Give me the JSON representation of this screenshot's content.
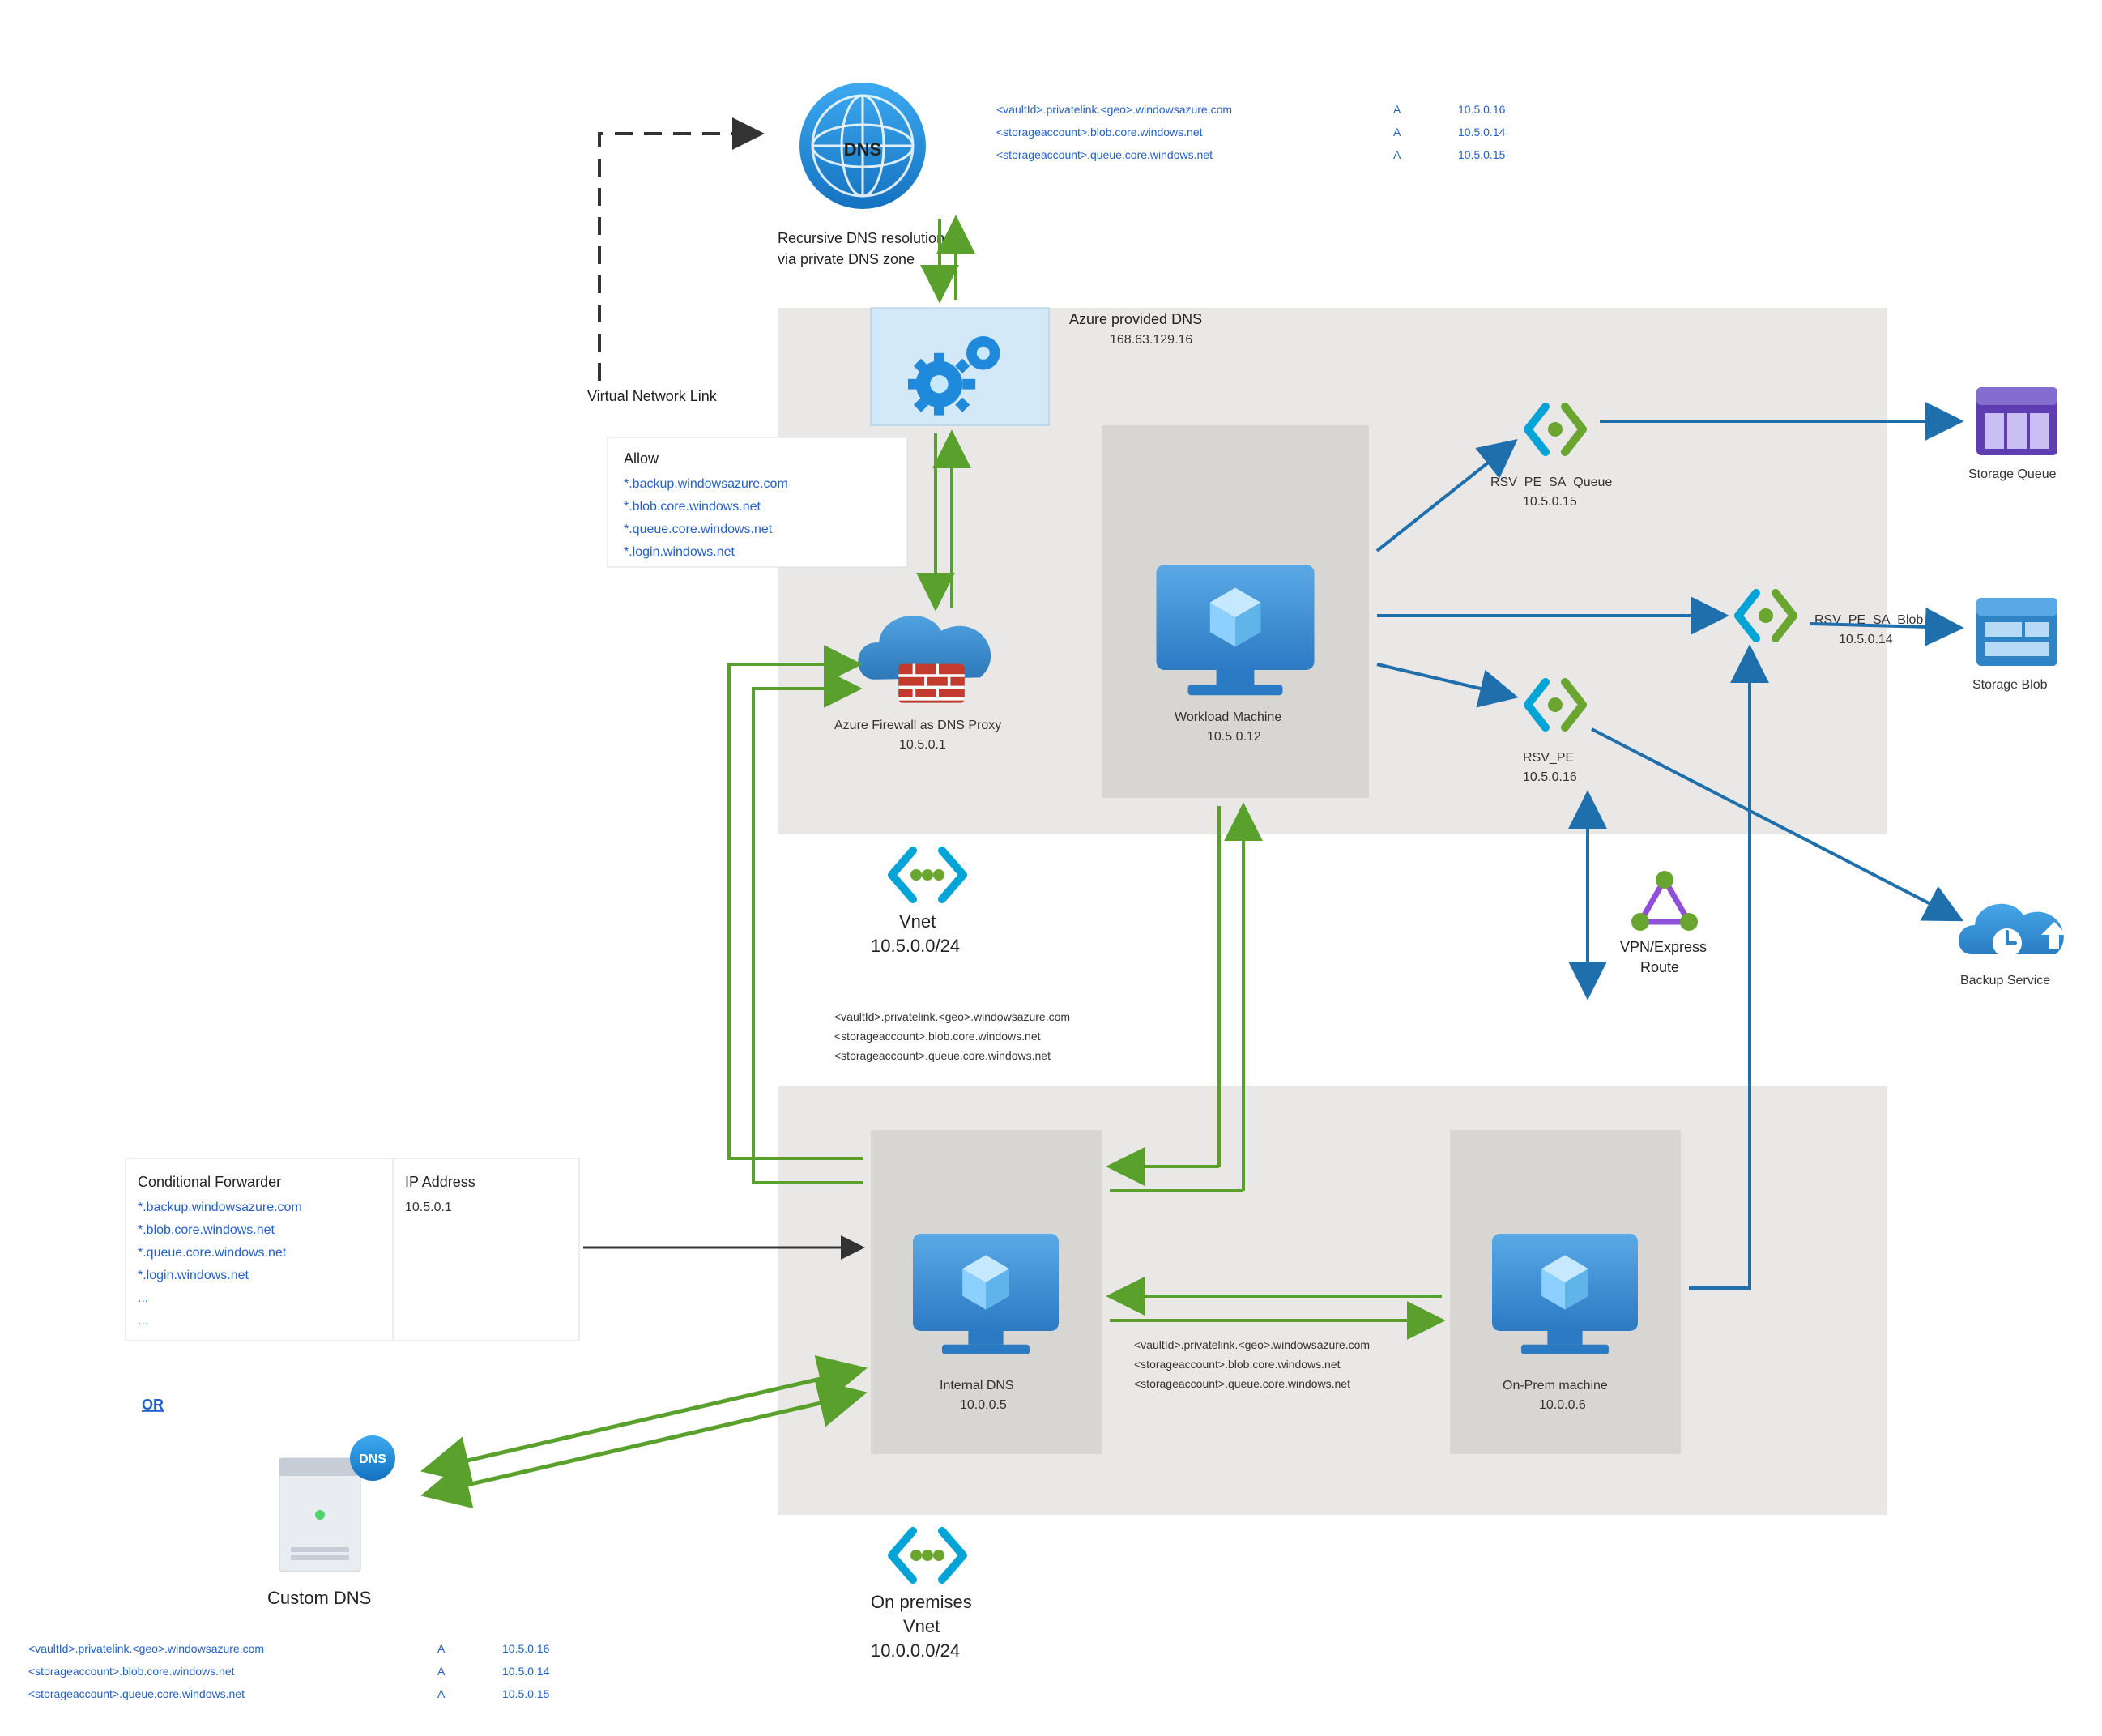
{
  "dns_circle_label": "DNS",
  "dns_caption_l1": "Recursive DNS resolution",
  "dns_caption_l2": "via private DNS zone",
  "dns_records_top": [
    {
      "host": "<vaultId>.privatelink.<geo>.windowsazure.com",
      "type": "A",
      "ip": "10.5.0.16"
    },
    {
      "host": "<storageaccount>.blob.core.windows.net",
      "type": "A",
      "ip": "10.5.0.14"
    },
    {
      "host": "<storageaccount>.queue.core.windows.net",
      "type": "A",
      "ip": "10.5.0.15"
    }
  ],
  "vnl_label": "Virtual Network Link",
  "azure_dns_title": "Azure provided DNS",
  "azure_dns_ip": "168.63.129.16",
  "allow_title": "Allow",
  "allow_list": [
    "*.backup.windowsazure.com",
    "*.blob.core.windows.net",
    "*.queue.core.windows.net",
    "*.login.windows.net"
  ],
  "firewall_label": "Azure Firewall as DNS Proxy",
  "firewall_ip": "10.5.0.1",
  "workload_label": "Workload Machine",
  "workload_ip": "10.5.0.12",
  "pe_queue_label": "RSV_PE_SA_Queue",
  "pe_queue_ip": "10.5.0.15",
  "pe_blob_label": "RSV_PE_SA_Blob",
  "pe_blob_ip": "10.5.0.14",
  "pe_rsv_label": "RSV_PE",
  "pe_rsv_ip": "10.5.0.16",
  "storage_queue_label": "Storage Queue",
  "storage_blob_label": "Storage Blob",
  "backup_service_label": "Backup Service",
  "vnet_label": "Vnet",
  "vnet_cidr": "10.5.0.0/24",
  "vpn_label_l1": "VPN/Express",
  "vpn_label_l2": "Route",
  "mid_records": [
    "<vaultId>.privatelink.<geo>.windowsazure.com",
    "<storageaccount>.blob.core.windows.net",
    "<storageaccount>.queue.core.windows.net"
  ],
  "cond_fwd_title": "Conditional Forwarder",
  "cond_fwd_ip_title": "IP Address",
  "cond_fwd_ip": "10.5.0.1",
  "cond_fwd_list": [
    "*.backup.windowsazure.com",
    "*.blob.core.windows.net",
    "*.queue.core.windows.net",
    "*.login.windows.net",
    "...",
    "..."
  ],
  "or_label": "OR",
  "custom_dns_label": "Custom DNS",
  "internal_dns_label": "Internal DNS",
  "internal_dns_ip": "10.0.0.5",
  "onprem_machine_label": "On-Prem machine",
  "onprem_machine_ip": "10.0.0.6",
  "onprem_records": [
    "<vaultId>.privatelink.<geo>.windowsazure.com",
    "<storageaccount>.blob.core.windows.net",
    "<storageaccount>.queue.core.windows.net"
  ],
  "onprem_vnet_label": "On premises",
  "onprem_vnet_label2": "Vnet",
  "onprem_vnet_cidr": "10.0.0.0/24",
  "dns_records_bottom": [
    {
      "host": "<vaultId>.privatelink.<geo>.windowsazure.com",
      "type": "A",
      "ip": "10.5.0.16"
    },
    {
      "host": "<storageaccount>.blob.core.windows.net",
      "type": "A",
      "ip": "10.5.0.14"
    },
    {
      "host": "<storageaccount>.queue.core.windows.net",
      "type": "A",
      "ip": "10.5.0.15"
    }
  ]
}
